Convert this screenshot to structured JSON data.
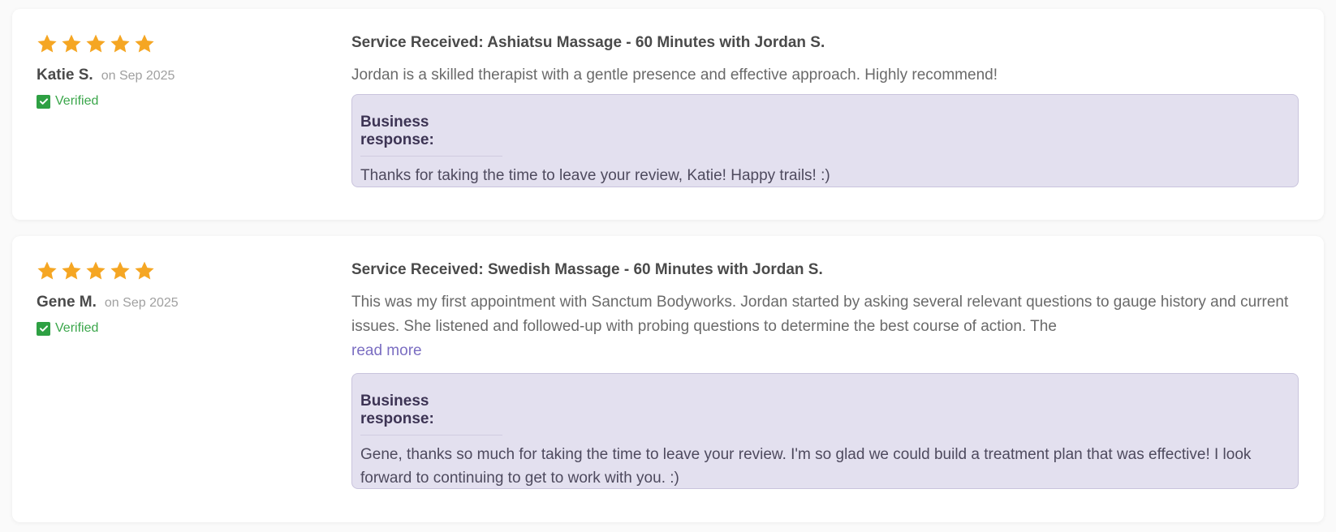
{
  "reviews": [
    {
      "rating": 5,
      "name": "Katie S.",
      "date": "on Sep 2025",
      "verified_label": "Verified",
      "service": "Service Received: Ashiatsu Massage - 60 Minutes with Jordan S.",
      "text": "Jordan is a skilled therapist with a gentle presence and effective approach. Highly recommend!",
      "read_more": "",
      "response_title": "Business response:",
      "response_text": "Thanks for taking the time to leave your review, Katie! Happy trails! :)"
    },
    {
      "rating": 5,
      "name": "Gene M.",
      "date": "on Sep 2025",
      "verified_label": "Verified",
      "service": "Service Received: Swedish Massage - 60 Minutes with Jordan S.",
      "text": "This was my first appointment with Sanctum Bodyworks. Jordan started by asking several relevant questions to gauge history and current issues. She listened and followed-up with probing questions to determine the best course of action. The",
      "read_more": "read more",
      "response_title": "Business response:",
      "response_text": "Gene, thanks so much for taking the time to leave your review. I'm so glad we could build a treatment plan that was effective! I look forward to continuing to get to work with you. :)"
    }
  ],
  "colors": {
    "star": "#f5a623",
    "verified": "#2ea043",
    "response_bg": "#e3e0ef",
    "read_more": "#7b6ec2"
  },
  "icons": {
    "star": "star-icon",
    "verified": "check-icon"
  }
}
